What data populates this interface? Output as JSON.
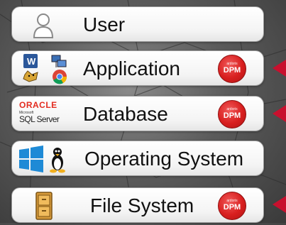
{
  "layers": [
    {
      "id": "user",
      "label": "User",
      "icons": [
        "user-icon"
      ],
      "has_dpm": false
    },
    {
      "id": "application",
      "label": "Application",
      "icons": [
        "word-icon",
        "network-icon",
        "tomcat-icon",
        "chrome-icon"
      ],
      "has_dpm": true
    },
    {
      "id": "database",
      "label": "Database",
      "icons": [
        "oracle-logo",
        "sql-server-logo"
      ],
      "has_dpm": true
    },
    {
      "id": "operating_system",
      "label": "Operating System",
      "icons": [
        "windows-icon",
        "linux-tux-icon"
      ],
      "has_dpm": true
    },
    {
      "id": "file_system",
      "label": "File System",
      "icons": [
        "file-cabinet-icon"
      ],
      "has_dpm": true
    }
  ],
  "dpm_badge": {
    "top_text": "ardoris",
    "main_text": "DPM"
  },
  "logos": {
    "oracle": "ORACLE",
    "microsoft": "Microsoft",
    "sql_server": "SQL Server",
    "word_letter": "W"
  },
  "colors": {
    "dpm_red": "#d81f1f",
    "arrow_red": "#c8102e",
    "oracle_red": "#e32b1f",
    "windows_blue": "#1e8ad6"
  }
}
